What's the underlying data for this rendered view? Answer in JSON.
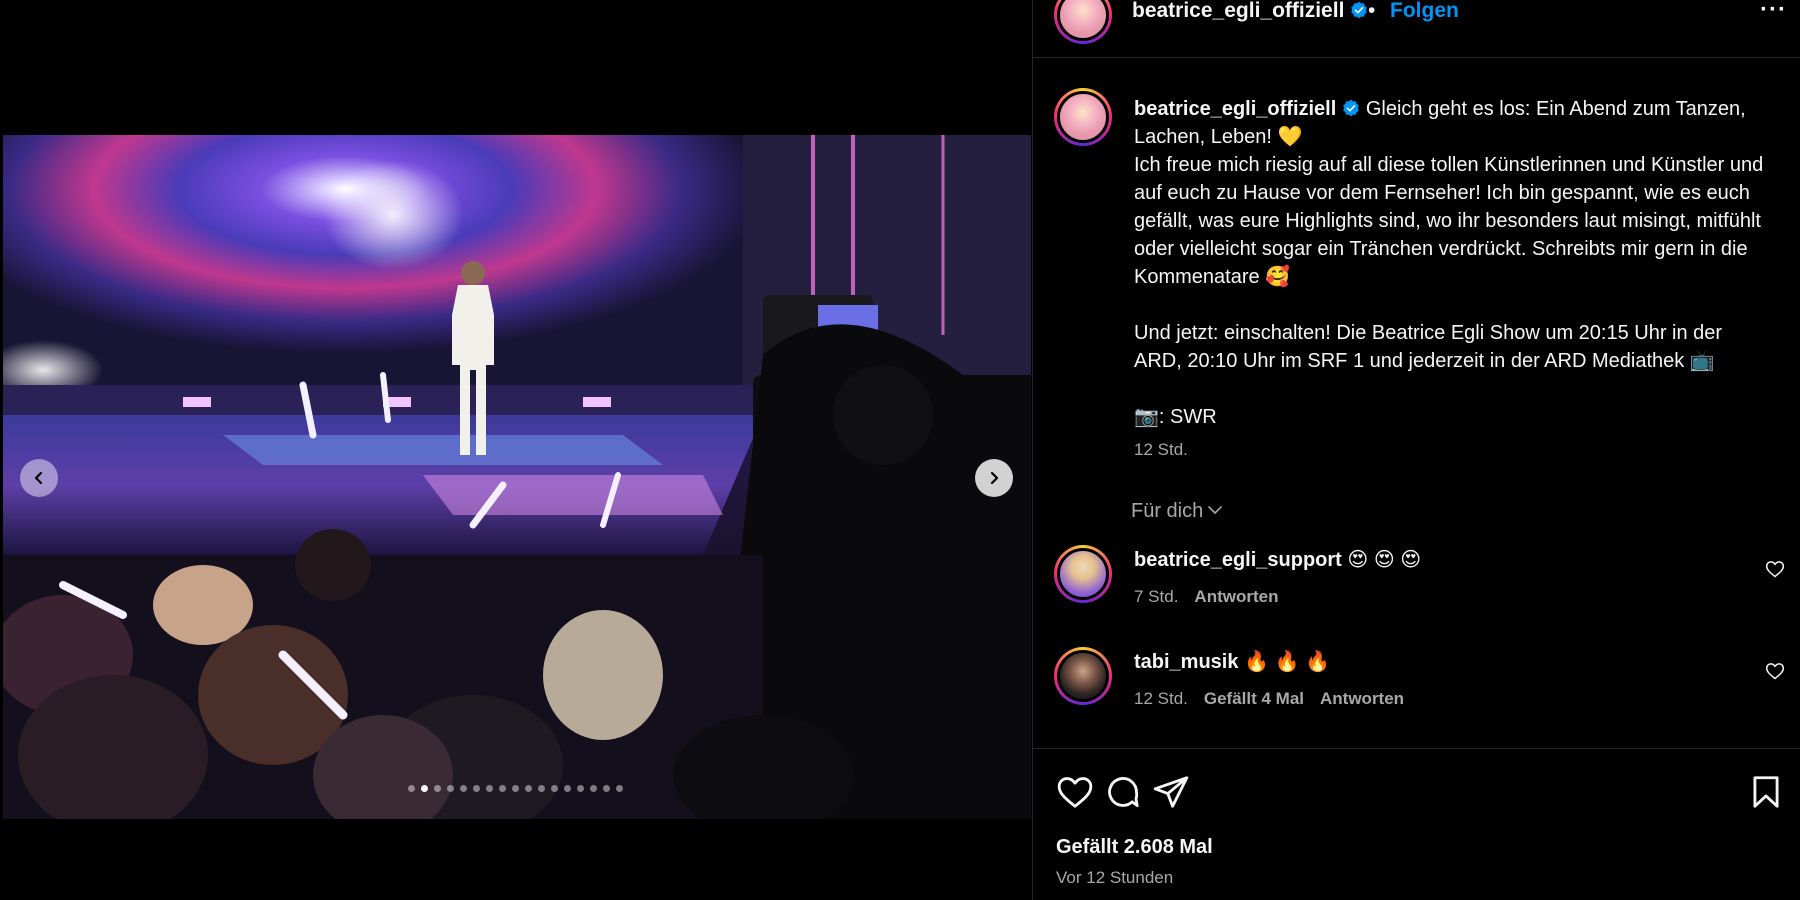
{
  "post": {
    "username": "beatrice_egli_offiziell",
    "separator": "•",
    "follow_label": "Folgen",
    "more_label": "···",
    "carousel": {
      "slide_count": 17,
      "active_index": 1
    }
  },
  "caption": {
    "username": "beatrice_egli_offiziell",
    "text": " Gleich geht es los: Ein Abend zum Tanzen, Lachen, Leben! 💛\nIch freue mich riesig auf all diese tollen Künstlerinnen und Künstler und auf euch zu Hause vor dem Fernseher! Ich bin gespannt, wie es euch gefällt, was eure Highlights sind, wo ihr besonders laut misingt, mitfühlt oder vielleicht sogar ein Tränchen verdrückt. Schreibts mir gern in die Kommenatare 🥰\n\nUnd jetzt: einschalten! Die Beatrice Egli Show um 20:15 Uhr in der ARD, 20:10 Uhr im SRF 1 und jederzeit in der ARD Mediathek 📺\n\n📷: SWR",
    "time": "12 Std."
  },
  "comments_filter": {
    "label": "Für dich"
  },
  "comments": [
    {
      "user": "beatrice_egli_support",
      "text": "😍 😍 😍",
      "time": "7 Std.",
      "likes": "",
      "reply": "Antworten"
    },
    {
      "user": "tabi_musik",
      "text": "🔥 🔥 🔥",
      "time": "12 Std.",
      "likes": "Gefällt 4 Mal",
      "reply": "Antworten"
    }
  ],
  "footer": {
    "likes_label": "Gefällt 2.608 Mal",
    "posted": "Vor 12 Stunden"
  },
  "colors": {
    "background": "#000000",
    "link_blue": "#0095f6",
    "verified_blue": "#0095f6",
    "muted_text": "#a8a8a8",
    "divider": "#262626"
  },
  "icons": [
    "verified-badge-icon",
    "more-options-icon",
    "chevron-left-icon",
    "chevron-right-icon",
    "chevron-down-icon",
    "heart-icon",
    "comment-icon",
    "share-icon",
    "bookmark-icon"
  ]
}
